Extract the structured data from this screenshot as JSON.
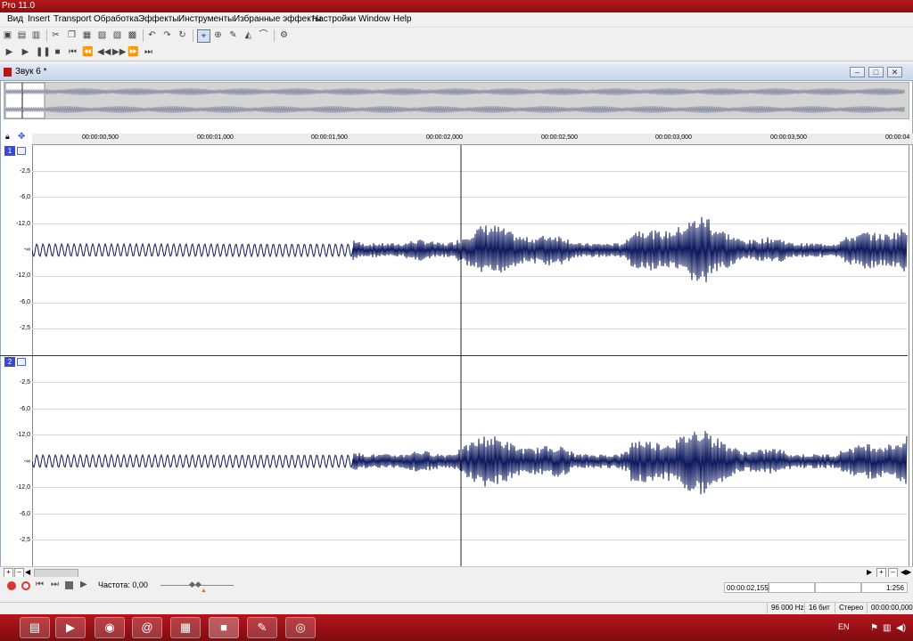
{
  "window": {
    "title": "Pro 11.0"
  },
  "menu": {
    "items": [
      "Вид",
      "Insert",
      "Transport",
      "Обработка",
      "Эффекты",
      "Инструменты",
      "Избранные эффекты",
      "Настройки",
      "Window",
      "Help"
    ]
  },
  "document": {
    "title": "Звук 6 *"
  },
  "ruler": {
    "ticks": [
      "00:00:00,500",
      "00:00:01,000",
      "00:00:01,500",
      "00:00:02,000",
      "00:00:02,500",
      "00:00:03,000",
      "00:00:03,500",
      "00:00:04"
    ]
  },
  "channels": [
    {
      "number": "1",
      "db_labels": [
        "-2,5",
        "-6,0",
        "-12,0",
        "-∞",
        "-12,0",
        "-6,0",
        "-2,5"
      ]
    },
    {
      "number": "2",
      "db_labels": [
        "-2,5",
        "-6,0",
        "-12,0",
        "-∞",
        "-12,0",
        "-6,0",
        "-2,5"
      ]
    }
  ],
  "transport": {
    "rate_label": "Частота: 0,00",
    "position": "00:00:02,155",
    "zoom": "1:256"
  },
  "status": {
    "sample_rate": "96 000 Hz",
    "bit_depth": "16 бит",
    "channels": "Стерео",
    "time": "00:00:00,000"
  },
  "taskbar": {
    "lang": "EN"
  },
  "colors": {
    "waveform": "#0d1a5e",
    "titlebar": "#a8141a",
    "taskbar": "#9a1016",
    "channel_badge": "#3a4bd0"
  }
}
